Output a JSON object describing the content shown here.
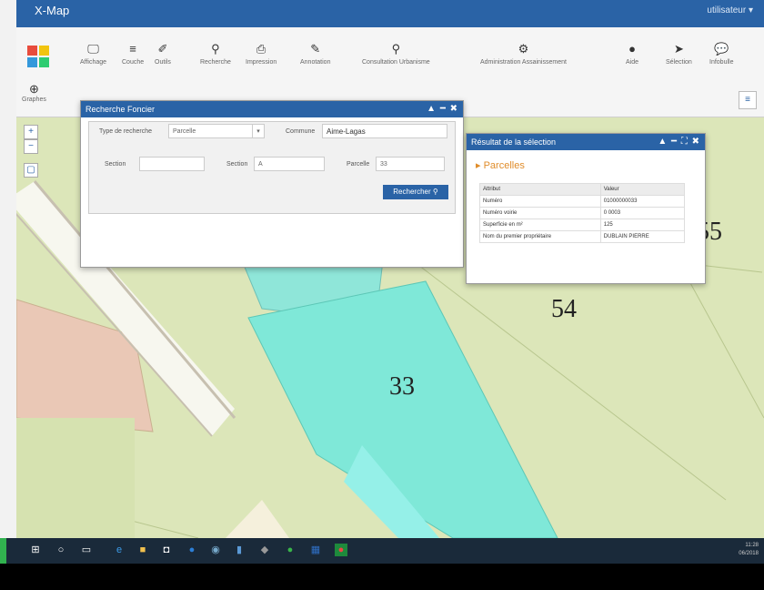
{
  "app": {
    "title": "X-Map",
    "user": "utilisateur ▾"
  },
  "toolbar": {
    "tools": [
      {
        "label": "Affichage",
        "icon": "monitor-icon",
        "glyph": "🖵"
      },
      {
        "label": "Couche",
        "icon": "list-icon",
        "glyph": "≡"
      },
      {
        "label": "Outils",
        "icon": "wrench-icon",
        "glyph": "✐"
      },
      {
        "label": "Recherche",
        "icon": "search-icon",
        "glyph": "⚲"
      },
      {
        "label": "Impression",
        "icon": "printer-icon",
        "glyph": "⎙"
      },
      {
        "label": "Annotation",
        "icon": "pencil-icon",
        "glyph": "✎"
      },
      {
        "label": "Consultation Urbanisme",
        "icon": "pin-icon",
        "glyph": "⚲"
      },
      {
        "label": "Administration Assainissement",
        "icon": "gear-icon",
        "glyph": "⚙"
      },
      {
        "label": "Aide",
        "icon": "help-icon",
        "glyph": "●"
      },
      {
        "label": "Sélection",
        "icon": "cursor-icon",
        "glyph": "➤"
      },
      {
        "label": "Infobulle",
        "icon": "comment-icon",
        "glyph": "💬"
      }
    ],
    "graphes_label": "Graphes",
    "menu_glyph": "≡"
  },
  "search_window": {
    "title": "Recherche Foncier",
    "controls": "▲ ━ ✖",
    "type_label": "Type de recherche",
    "type_value": "Parcelle",
    "commune_label": "Commune",
    "commune_value": "Aime-Lagas",
    "section_label": "Section",
    "section_value": "",
    "sec_label": "Section",
    "sec_value": "A",
    "parcelle_label": "Parcelle",
    "parcelle_value": "33",
    "button_label": "Rechercher ⚲"
  },
  "result_window": {
    "title": "Résultat de la sélection",
    "controls": "▲ ━ ⛶ ✖",
    "section": "▸ Parcelles",
    "headers": [
      "Attribut",
      "Valeur"
    ],
    "rows": [
      [
        "Numéro",
        "01000000033"
      ],
      [
        "Numéro voirie",
        "0 0003"
      ],
      [
        "Superficie en m²",
        "125"
      ],
      [
        "Nom du premier propriétaire",
        "DUBLAIN PIERRE"
      ]
    ]
  },
  "map": {
    "labels": [
      "55",
      "54",
      "33"
    ],
    "zoom_in": "+",
    "zoom_out": "−"
  },
  "taskbar": {
    "time": "11:28",
    "date": "06/2018"
  }
}
